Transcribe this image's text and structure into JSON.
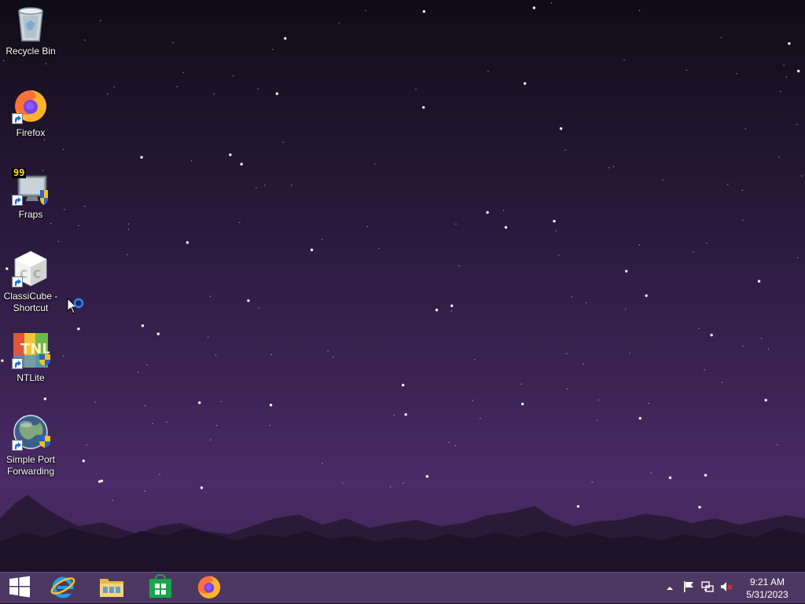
{
  "desktop": {
    "icons": [
      {
        "label": "Recycle Bin",
        "icon": "recycle-bin-icon"
      },
      {
        "label": "Firefox",
        "icon": "firefox-icon"
      },
      {
        "label": "Fraps",
        "icon": "fraps-icon",
        "fps_counter": "99"
      },
      {
        "label": "ClassiCube - Shortcut",
        "icon": "classicube-icon"
      },
      {
        "label": "NTLite",
        "icon": "ntlite-icon"
      },
      {
        "label": "Simple Port Forwarding",
        "icon": "simple-port-forwarding-icon"
      }
    ]
  },
  "taskbar": {
    "start": "start-windows-icon",
    "pinned": [
      {
        "name": "Internet Explorer",
        "icon": "internet-explorer-icon"
      },
      {
        "name": "File Explorer",
        "icon": "file-explorer-icon"
      },
      {
        "name": "Store",
        "icon": "store-icon"
      },
      {
        "name": "Firefox",
        "icon": "firefox-icon"
      }
    ],
    "tray": {
      "icons": [
        "show-hidden-icons-chevron",
        "action-center-flag-icon",
        "network-icon",
        "volume-muted-icon"
      ],
      "time": "9:21 AM",
      "date": "5/31/2023"
    }
  },
  "colors": {
    "sky_top": "#0f0c16",
    "sky_bottom": "#4a2b66",
    "taskbar": "#4e3a64"
  }
}
